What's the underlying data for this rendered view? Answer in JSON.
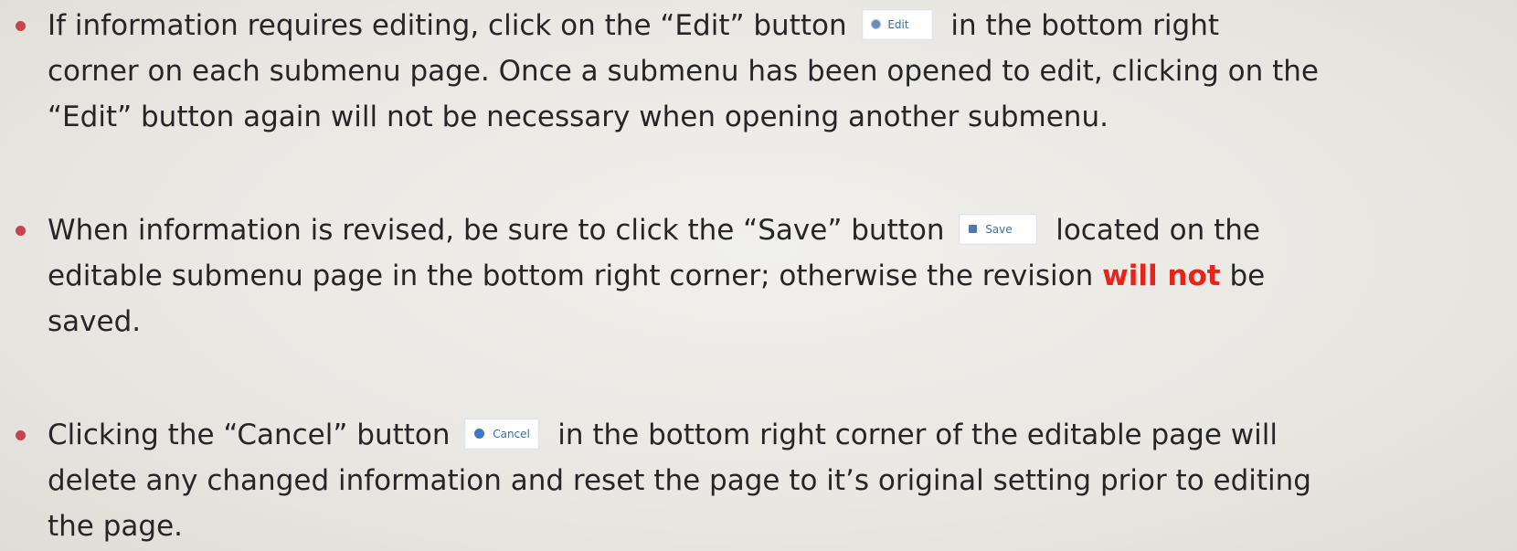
{
  "bullets": [
    {
      "lines": [
        {
          "before": "If information requires editing, click on the “Edit” button",
          "button": {
            "label": "Edit",
            "icon": "gear-icon"
          },
          "after": "in the bottom right"
        },
        {
          "text": "corner on each submenu page.  Once a submenu has been opened to edit, clicking on the"
        },
        {
          "text": "“Edit” button again will not be necessary when opening another submenu."
        }
      ]
    },
    {
      "lines": [
        {
          "before": "When information is revised, be sure to click the “Save” button",
          "button": {
            "label": "Save",
            "icon": "floppy-icon"
          },
          "after": "located on the"
        },
        {
          "before": "editable submenu page in the bottom right corner; otherwise the revision",
          "emphasis": "will not",
          "after": "be"
        },
        {
          "text": "saved."
        }
      ]
    },
    {
      "lines": [
        {
          "before": "Clicking the “Cancel” button",
          "button": {
            "label": "Cancel",
            "icon": "cancel-icon"
          },
          "after": "in the bottom right corner of the editable page will"
        },
        {
          "text": "delete any changed information and reset the page to it’s original setting prior to editing"
        },
        {
          "text": "the page."
        }
      ]
    }
  ],
  "colors": {
    "bullet": "#c9424f",
    "emphasis": "#e8231a",
    "button_text": "#3c6ea4",
    "background": "#e8e6e1"
  }
}
